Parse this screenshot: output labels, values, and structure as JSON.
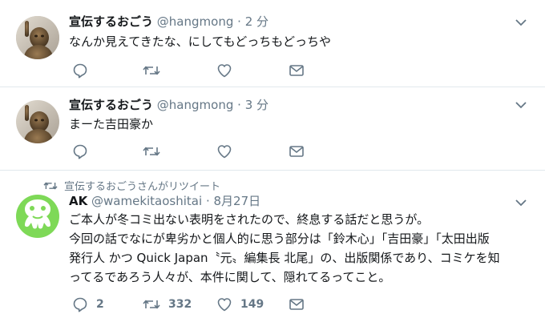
{
  "tweets": [
    {
      "name": "宣伝するおごう",
      "handle": "@hangmong",
      "dot": "·",
      "time": "2 分",
      "text": "なんか見えてきたな、にしてもどっちもどっちや",
      "reply_count": "",
      "retweet_count": "",
      "like_count": ""
    },
    {
      "name": "宣伝するおごう",
      "handle": "@hangmong",
      "dot": "·",
      "time": "3 分",
      "text": "まーた吉田豪か",
      "reply_count": "",
      "retweet_count": "",
      "like_count": ""
    },
    {
      "retweet_context": "宣伝するおごうさんがリツイート",
      "name": "AK",
      "handle": "@wamekitaoshitai",
      "dot": "·",
      "time": "8月27日",
      "text": "ご本人が冬コミ出ない表明をされたので、終息する話だと思うが。\n今回の話でなにが卑劣かと個人的に思う部分は「鈴木心」「吉田豪」「太田出版\n発行人 かつ Quick Japan〝元〟編集長 北尾」の、出版関係であり、コミケを知\nってるであろう人々が、本件に関して、隠れてるってこと。",
      "reply_count": "2",
      "retweet_count": "332",
      "like_count": "149"
    }
  ],
  "colors": {
    "text": "#14171a",
    "secondary": "#657786",
    "border": "#e1e8ed",
    "ak_avatar_bg": "#7ed957"
  },
  "icons": [
    "reply-icon",
    "retweet-icon",
    "like-icon",
    "message-icon",
    "caret-down-icon",
    "statue-avatar",
    "ak-avatar"
  ]
}
